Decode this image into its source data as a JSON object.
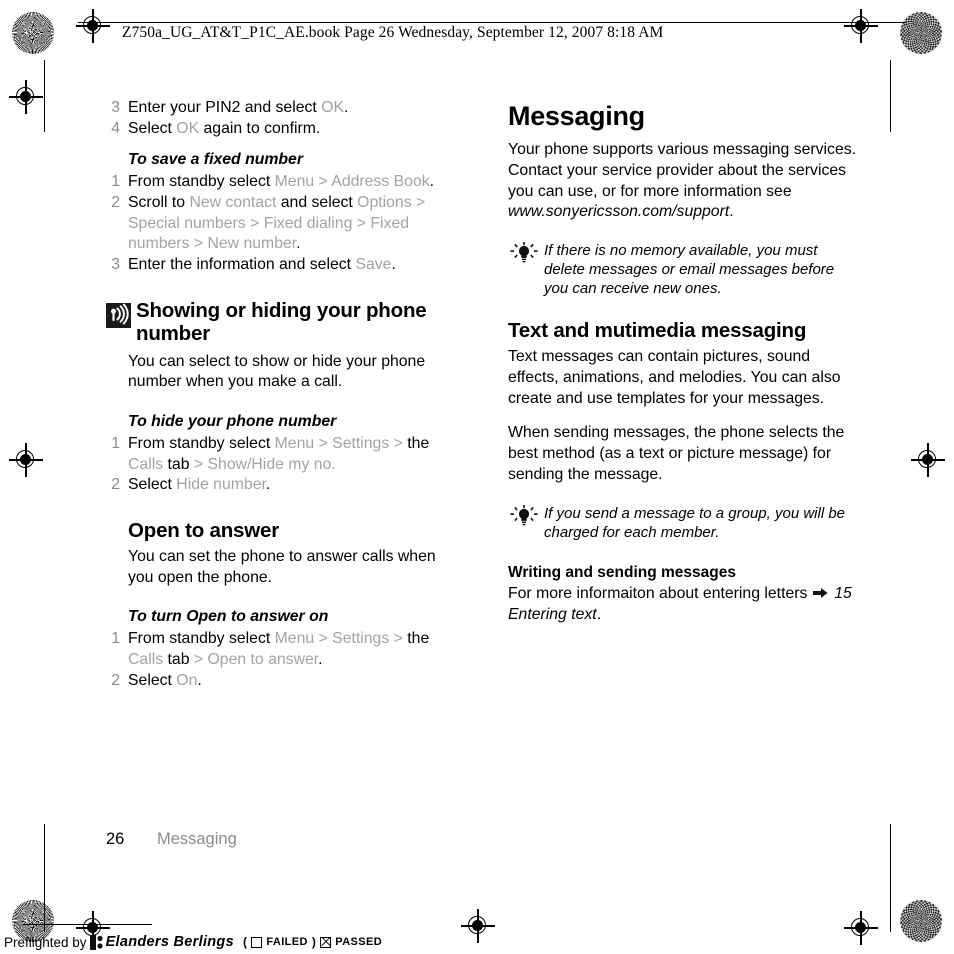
{
  "header": {
    "slug": "Z750a_UG_AT&T_P1C_AE.book  Page 26  Wednesday, September 12, 2007  8:18 AM"
  },
  "left_column": {
    "continued_steps": [
      {
        "num": "3",
        "parts": [
          {
            "t": "Enter your PIN2 and select ",
            "s": "normal"
          },
          {
            "t": "OK",
            "s": "ui"
          },
          {
            "t": ".",
            "s": "normal"
          }
        ]
      },
      {
        "num": "4",
        "parts": [
          {
            "t": "Select ",
            "s": "normal"
          },
          {
            "t": "OK",
            "s": "ui"
          },
          {
            "t": " again to confirm.",
            "s": "normal"
          }
        ]
      }
    ],
    "procedure_1": {
      "title": "To save a fixed number",
      "steps": [
        {
          "num": "1",
          "parts": [
            {
              "t": "From standby select ",
              "s": "normal"
            },
            {
              "t": "Menu",
              "s": "ui"
            },
            {
              "t": " > ",
              "s": "sep"
            },
            {
              "t": "Address Book",
              "s": "ui"
            },
            {
              "t": ".",
              "s": "normal"
            }
          ]
        },
        {
          "num": "2",
          "parts": [
            {
              "t": "Scroll to ",
              "s": "normal"
            },
            {
              "t": "New contact",
              "s": "ui"
            },
            {
              "t": " and select ",
              "s": "normal"
            },
            {
              "t": "Options",
              "s": "ui"
            },
            {
              "t": " > ",
              "s": "sep"
            },
            {
              "t": "Special numbers",
              "s": "ui"
            },
            {
              "t": " > ",
              "s": "sep"
            },
            {
              "t": "Fixed dialing",
              "s": "ui"
            },
            {
              "t": " > ",
              "s": "sep"
            },
            {
              "t": "Fixed numbers",
              "s": "ui"
            },
            {
              "t": " > ",
              "s": "sep"
            },
            {
              "t": "New number",
              "s": "ui"
            },
            {
              "t": ".",
              "s": "normal"
            }
          ]
        },
        {
          "num": "3",
          "parts": [
            {
              "t": "Enter the information and select ",
              "s": "normal"
            },
            {
              "t": "Save",
              "s": "ui"
            },
            {
              "t": ".",
              "s": "normal"
            }
          ]
        }
      ]
    },
    "section_1": {
      "icon": "signal-broadcast-icon",
      "title": "Showing or hiding your phone number",
      "body": "You can select to show or hide your phone number when you make a call."
    },
    "procedure_2": {
      "title": "To hide your phone number",
      "steps": [
        {
          "num": "1",
          "parts": [
            {
              "t": "From standby select ",
              "s": "normal"
            },
            {
              "t": "Menu",
              "s": "ui"
            },
            {
              "t": " > ",
              "s": "sep"
            },
            {
              "t": "Settings",
              "s": "ui"
            },
            {
              "t": " > ",
              "s": "sep"
            },
            {
              "t": "the ",
              "s": "normal"
            },
            {
              "t": "Calls",
              "s": "ui"
            },
            {
              "t": " tab",
              "s": "normal"
            },
            {
              "t": " > ",
              "s": "sep"
            },
            {
              "t": "Show/Hide my no.",
              "s": "ui"
            }
          ]
        },
        {
          "num": "2",
          "parts": [
            {
              "t": "Select ",
              "s": "normal"
            },
            {
              "t": "Hide number",
              "s": "ui"
            },
            {
              "t": ".",
              "s": "normal"
            }
          ]
        }
      ]
    },
    "section_2": {
      "title": "Open to answer",
      "body": "You can set the phone to answer calls when you open the phone."
    },
    "procedure_3": {
      "title": "To turn Open to answer on",
      "steps": [
        {
          "num": "1",
          "parts": [
            {
              "t": "From standby select ",
              "s": "normal"
            },
            {
              "t": "Menu",
              "s": "ui"
            },
            {
              "t": " > ",
              "s": "sep"
            },
            {
              "t": "Settings",
              "s": "ui"
            },
            {
              "t": " > ",
              "s": "sep"
            },
            {
              "t": "the ",
              "s": "normal"
            },
            {
              "t": "Calls",
              "s": "ui"
            },
            {
              "t": " tab",
              "s": "normal"
            },
            {
              "t": " > ",
              "s": "sep"
            },
            {
              "t": "Open to answer",
              "s": "ui"
            },
            {
              "t": ".",
              "s": "normal"
            }
          ]
        },
        {
          "num": "2",
          "parts": [
            {
              "t": "Select ",
              "s": "normal"
            },
            {
              "t": "On",
              "s": "ui"
            },
            {
              "t": ".",
              "s": "normal"
            }
          ]
        }
      ]
    }
  },
  "right_column": {
    "chapter_title": "Messaging",
    "intro_parts": [
      {
        "t": "Your phone supports various messaging services. Contact your service provider about the services you can use, or for more information see ",
        "s": "normal"
      },
      {
        "t": "www.sonyericsson.com/support",
        "s": "italic"
      },
      {
        "t": ".",
        "s": "normal"
      }
    ],
    "tip_1": {
      "icon": "lightbulb-tip-icon",
      "text": "If there is no memory available, you must delete messages or email messages before you can receive new ones."
    },
    "section_1": {
      "title": "Text and mutimedia messaging",
      "body_1": "Text messages can contain pictures, sound effects, animations, and melodies. You can also create and use templates for your messages.",
      "body_2": "When sending messages, the phone selects the best method (as a text or picture message) for sending the message."
    },
    "tip_2": {
      "icon": "lightbulb-tip-icon",
      "text": "If you send a message to a group, you will be charged for each member."
    },
    "section_2": {
      "title": "Writing and sending messages",
      "body_parts": [
        {
          "t": "For more informaiton about entering letters ",
          "s": "normal"
        },
        {
          "t": "ARROW",
          "s": "arrow"
        },
        {
          "t": " ",
          "s": "normal"
        },
        {
          "t": "15 Entering text",
          "s": "italic"
        },
        {
          "t": ".",
          "s": "normal"
        }
      ]
    }
  },
  "footer": {
    "page_number": "26",
    "chapter": "Messaging"
  },
  "preflight": {
    "prefix": "Preflighted by",
    "brand": "Elanders Berlings",
    "open_paren": "(",
    "failed_label": "FAILED",
    "close_paren": ")",
    "passed_label": "PASSED"
  },
  "colors": {
    "ui_term_grey": "#a3a3a3",
    "step_number_grey": "#8c8c8c",
    "footer_chapter_grey": "#8c8c8c",
    "icon_dark": "#1b1b1b"
  }
}
